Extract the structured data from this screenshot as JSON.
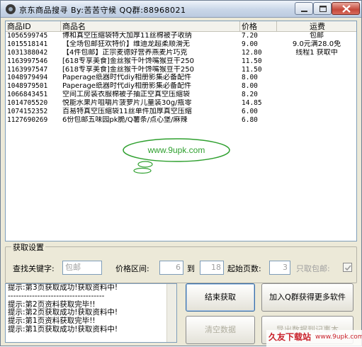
{
  "window": {
    "title": "京东商品搜寻  By:苦苦守候  QQ群:88968021"
  },
  "table": {
    "columns": [
      "商品ID",
      "商品名",
      "价格",
      "运费"
    ],
    "rows": [
      {
        "id": "1056599745",
        "name": "博和真空压缩袋特大加厚11丝棉被子收纳",
        "price": "7.20",
        "ship": "包邮"
      },
      {
        "id": "1015518141",
        "name": "【全场包邮狂欢特价】维迪龙超柔顺滑无",
        "price": "9.00",
        "ship": "9.0元满28.0免"
      },
      {
        "id": "1031388042",
        "name": "【4件包邮】正宗麦德好营养燕麦片巧克",
        "price": "12.80",
        "ship": "线程1 获取中"
      },
      {
        "id": "1163997546",
        "name": "[618专享美食]金丝猴千叶馋嘴猴豆干250",
        "price": "11.50",
        "ship": ""
      },
      {
        "id": "1163997547",
        "name": "[618专享美食]金丝猴千叶馋嘴猴豆干250",
        "price": "11.50",
        "ship": ""
      },
      {
        "id": "1048979494",
        "name": "Paperage纸器时代diy相册影集必备配件",
        "price": "8.00",
        "ship": ""
      },
      {
        "id": "1048979501",
        "name": "Paperage纸器时代diy相册影集必备配件",
        "price": "8.00",
        "ship": ""
      },
      {
        "id": "1066843451",
        "name": "空间工房装衣服棉被子抽正空真空压缩袋",
        "price": "8.20",
        "ship": ""
      },
      {
        "id": "1014705520",
        "name": "悦能水果片咀嚼片菠萝片儿童装30g/瓶零",
        "price": "14.85",
        "ship": ""
      },
      {
        "id": "1074152352",
        "name": "百易特真空压缩袋11丝单件加厚真空压缩",
        "price": "6.00",
        "ship": ""
      },
      {
        "id": "1127690269",
        "name": "6份包邮五味园pk脆/Q薯条/点心堡/麻辣",
        "price": "6.80",
        "ship": ""
      }
    ]
  },
  "settings": {
    "legend": "获取设置",
    "keyword_label": "查找关键字:",
    "keyword_value": "包邮",
    "price_label": "价格区间:",
    "price_min": "6",
    "price_to": "到",
    "price_max": "18",
    "start_page_label": "起始页数:",
    "start_page_value": "3",
    "free_ship_label": "只取包邮:",
    "free_ship_checked": true
  },
  "log": {
    "lines": [
      "提示:第3页获取成功!获取资料中!",
      "------------------------------------",
      "提示:第2页资料获取完毕!!",
      "提示:第2页获取成功!获取资料中!",
      "提示:第1页资料获取完毕!!",
      "提示:第1页获取成功!获取资料中!"
    ]
  },
  "buttons": {
    "stop": "结束获取",
    "join": "加入Q群获得更多软件",
    "clear": "清空数据",
    "export": "导出数据到记事本"
  },
  "watermarks": {
    "bubble_text": "www.9upk.com",
    "bottom_text": "久友下载站",
    "bottom_url": "www.9upk.com"
  },
  "colors": {
    "window_bg": "#ece9d8",
    "watermark_green": "#2fa02f",
    "watermark_red": "#c9212b"
  }
}
